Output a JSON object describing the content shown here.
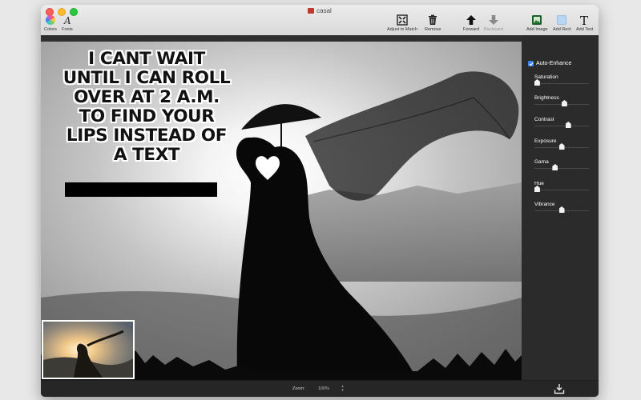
{
  "window": {
    "title": "casal"
  },
  "toolbar": {
    "colors_label": "Colors",
    "fonts_label": "Fonts",
    "adjust_label": "Adjust to Match",
    "remove_label": "Remove",
    "forward_label": "Forward",
    "backward_label": "Backward",
    "add_image_label": "Add Image",
    "add_rect_label": "Add Rect",
    "add_text_label": "Add Text"
  },
  "canvas": {
    "meme_lines": [
      "I CANT WAIT",
      "UNTIL I CAN ROLL",
      "OVER AT 2 A.M.",
      "TO FIND YOUR",
      "LIPS INSTEAD OF",
      "A TEXT"
    ]
  },
  "sidebar": {
    "auto_enhance": {
      "label": "Auto-Enhance",
      "checked": true
    },
    "sliders": [
      {
        "label": "Saturation",
        "value": 0.05
      },
      {
        "label": "Brightness",
        "value": 0.55
      },
      {
        "label": "Contrast",
        "value": 0.62
      },
      {
        "label": "Exposure",
        "value": 0.5
      },
      {
        "label": "Gama",
        "value": 0.38
      },
      {
        "label": "Hue",
        "value": 0.05
      },
      {
        "label": "Vibrance",
        "value": 0.5
      }
    ]
  },
  "bottombar": {
    "zoom_label": "Zoom:",
    "zoom_value": "100%"
  },
  "colors": {
    "accent": "#3b84f5",
    "sidebar_bg": "#2b2b2b"
  }
}
